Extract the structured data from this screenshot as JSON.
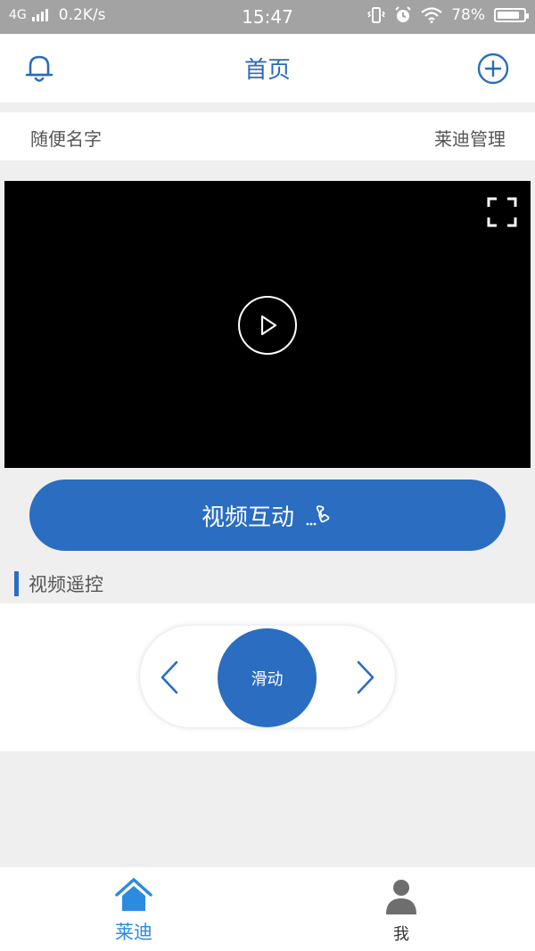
{
  "status_bar": {
    "network": "4G",
    "speed": "0.2K/s",
    "time": "15:47",
    "battery": "78%"
  },
  "header": {
    "title": "首页",
    "left_icon": "bell-icon",
    "right_icon": "plus-circle-icon"
  },
  "subheader": {
    "left_label": "随便名字",
    "right_label": "莱迪管理"
  },
  "video": {
    "play_icon": "play-icon",
    "fullscreen_icon": "fullscreen-icon"
  },
  "interact_button": {
    "label": "视频互动",
    "icon": "phone-call-icon"
  },
  "section": {
    "title": "视频遥控"
  },
  "remote": {
    "slider_label": "滑动",
    "left_icon": "chevron-left-icon",
    "right_icon": "chevron-right-icon"
  },
  "bottom_nav": {
    "items": [
      {
        "label": "莱迪",
        "icon": "home-icon",
        "active": true
      },
      {
        "label": "我",
        "icon": "person-icon",
        "active": false
      }
    ]
  },
  "colors": {
    "accent": "#2a6dc1",
    "title_blue": "#2b6cb8",
    "nav_active": "#2a8be0",
    "status_bar_bg": "#a3a3a3"
  }
}
